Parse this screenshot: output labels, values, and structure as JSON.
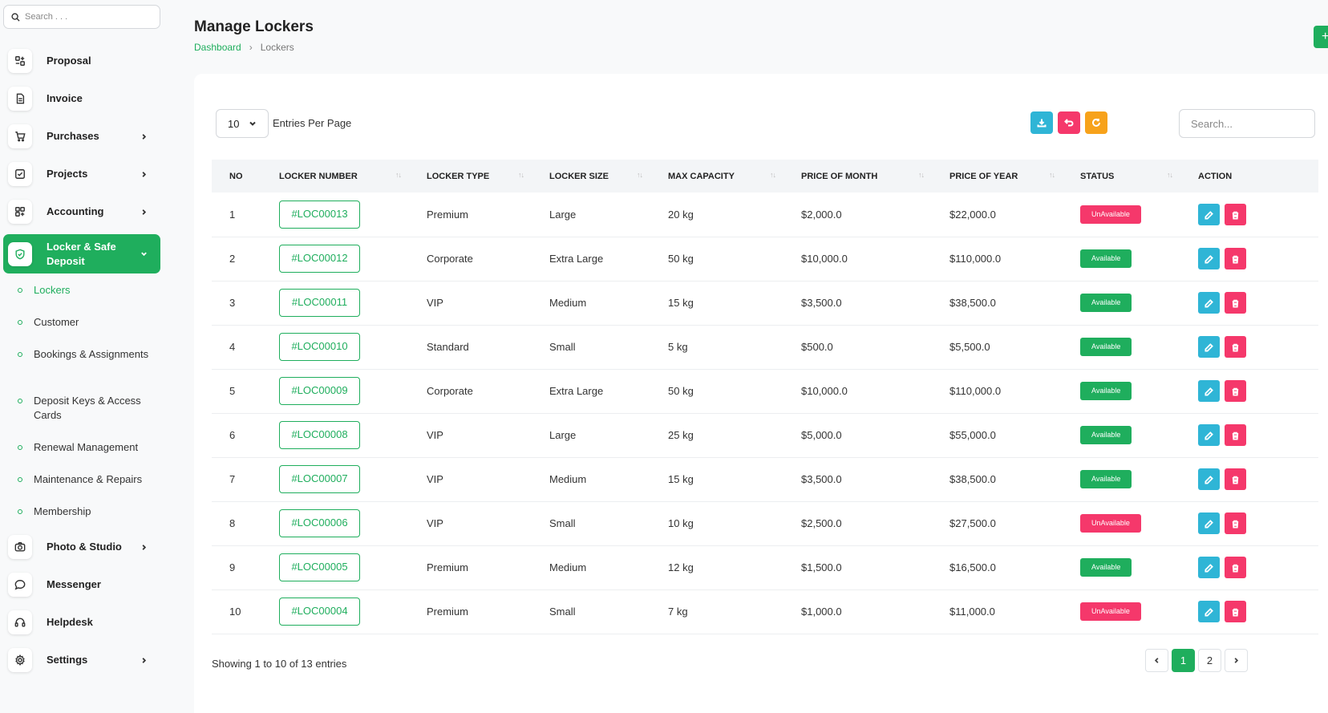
{
  "sidebar": {
    "search_placeholder": "Search . . .",
    "items": [
      {
        "label": "Proposal",
        "icon": "proposal-icon",
        "chevron": false
      },
      {
        "label": "Invoice",
        "icon": "invoice-icon",
        "chevron": false
      },
      {
        "label": "Purchases",
        "icon": "cart-icon",
        "chevron": true
      },
      {
        "label": "Projects",
        "icon": "projects-icon",
        "chevron": true
      },
      {
        "label": "Accounting",
        "icon": "accounting-icon",
        "chevron": true
      },
      {
        "label": "Locker & Safe Deposit",
        "icon": "shield-icon",
        "chevron": true,
        "active": true
      },
      {
        "label": "Photo & Studio",
        "icon": "camera-icon",
        "chevron": true
      },
      {
        "label": "Messenger",
        "icon": "chat-icon",
        "chevron": false
      },
      {
        "label": "Helpdesk",
        "icon": "headset-icon",
        "chevron": false
      },
      {
        "label": "Settings",
        "icon": "gear-icon",
        "chevron": true
      }
    ],
    "sub_items": [
      {
        "label": "Lockers",
        "active": true
      },
      {
        "label": "Customer"
      },
      {
        "label": "Bookings & Assignments"
      },
      {
        "label": "Deposit Keys & Access Cards"
      },
      {
        "label": "Renewal Management"
      },
      {
        "label": "Maintenance & Repairs"
      },
      {
        "label": "Membership"
      }
    ]
  },
  "header": {
    "title": "Manage Lockers",
    "breadcrumb": [
      "Dashboard",
      "Lockers"
    ],
    "add_button": "+"
  },
  "toolbar": {
    "entries_value": "10",
    "entries_label": "Entries Per Page",
    "search_placeholder": "Search...",
    "buttons": [
      {
        "name": "download-button",
        "icon": "download-icon",
        "color": "#2fb5d6"
      },
      {
        "name": "reset-button",
        "icon": "undo-icon",
        "color": "#f5386b"
      },
      {
        "name": "refresh-button",
        "icon": "refresh-icon",
        "color": "#f7a21b"
      }
    ]
  },
  "table": {
    "columns": [
      "NO",
      "LOCKER NUMBER",
      "LOCKER TYPE",
      "LOCKER SIZE",
      "MAX CAPACITY",
      "PRICE OF MONTH",
      "PRICE OF YEAR",
      "STATUS",
      "ACTION"
    ],
    "rows": [
      {
        "no": "1",
        "number": "#LOC00013",
        "type": "Premium",
        "size": "Large",
        "capacity": "20 kg",
        "month": "$2,000.0",
        "year": "$22,000.0",
        "status": "UnAvailable"
      },
      {
        "no": "2",
        "number": "#LOC00012",
        "type": "Corporate",
        "size": "Extra Large",
        "capacity": "50 kg",
        "month": "$10,000.0",
        "year": "$110,000.0",
        "status": "Available"
      },
      {
        "no": "3",
        "number": "#LOC00011",
        "type": "VIP",
        "size": "Medium",
        "capacity": "15 kg",
        "month": "$3,500.0",
        "year": "$38,500.0",
        "status": "Available"
      },
      {
        "no": "4",
        "number": "#LOC00010",
        "type": "Standard",
        "size": "Small",
        "capacity": "5 kg",
        "month": "$500.0",
        "year": "$5,500.0",
        "status": "Available"
      },
      {
        "no": "5",
        "number": "#LOC00009",
        "type": "Corporate",
        "size": "Extra Large",
        "capacity": "50 kg",
        "month": "$10,000.0",
        "year": "$110,000.0",
        "status": "Available"
      },
      {
        "no": "6",
        "number": "#LOC00008",
        "type": "VIP",
        "size": "Large",
        "capacity": "25 kg",
        "month": "$5,000.0",
        "year": "$55,000.0",
        "status": "Available"
      },
      {
        "no": "7",
        "number": "#LOC00007",
        "type": "VIP",
        "size": "Medium",
        "capacity": "15 kg",
        "month": "$3,500.0",
        "year": "$38,500.0",
        "status": "Available"
      },
      {
        "no": "8",
        "number": "#LOC00006",
        "type": "VIP",
        "size": "Small",
        "capacity": "10 kg",
        "month": "$2,500.0",
        "year": "$27,500.0",
        "status": "UnAvailable"
      },
      {
        "no": "9",
        "number": "#LOC00005",
        "type": "Premium",
        "size": "Medium",
        "capacity": "12 kg",
        "month": "$1,500.0",
        "year": "$16,500.0",
        "status": "Available"
      },
      {
        "no": "10",
        "number": "#LOC00004",
        "type": "Premium",
        "size": "Small",
        "capacity": "7 kg",
        "month": "$1,000.0",
        "year": "$11,000.0",
        "status": "UnAvailable"
      }
    ]
  },
  "footer": {
    "showing": "Showing 1 to 10 of 13 entries",
    "pages": [
      "1",
      "2"
    ],
    "current_page": "1"
  },
  "colors": {
    "accent": "#1fae5d",
    "danger": "#f5386b",
    "info": "#2fb5d6",
    "warning": "#f7a21b"
  }
}
